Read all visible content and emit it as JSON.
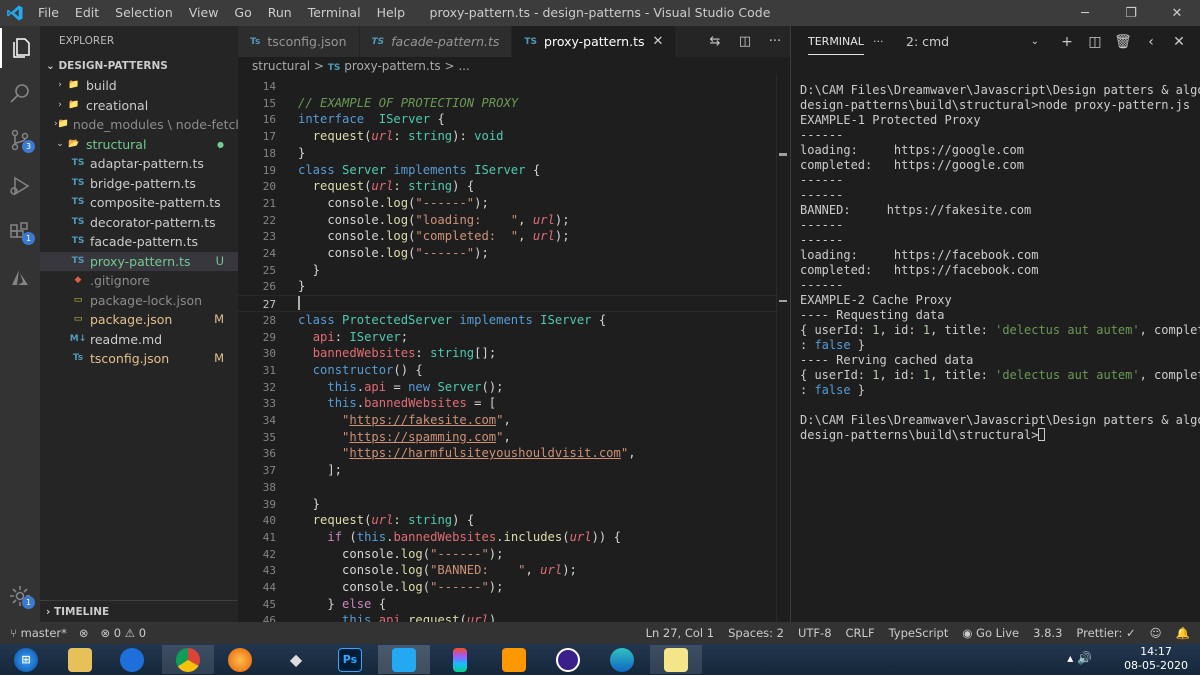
{
  "window": {
    "title": "proxy-pattern.ts - design-patterns - Visual Studio Code",
    "menu": [
      "File",
      "Edit",
      "Selection",
      "View",
      "Go",
      "Run",
      "Terminal",
      "Help"
    ]
  },
  "activity": {
    "scm_badge": "3",
    "ext_badge": "1",
    "settings_badge": "1"
  },
  "explorer": {
    "header": "EXPLORER",
    "project": "DESIGN-PATTERNS",
    "timeline": "TIMELINE",
    "items": [
      {
        "label": "build",
        "type": "folder",
        "status": ""
      },
      {
        "label": "creational",
        "type": "folder",
        "status": ""
      },
      {
        "label": "node_modules \\ node-fetch",
        "type": "folder",
        "status": ""
      },
      {
        "label": "structural",
        "type": "folder-open",
        "status": "●"
      },
      {
        "label": "adaptar-pattern.ts",
        "type": "ts",
        "status": ""
      },
      {
        "label": "bridge-pattern.ts",
        "type": "ts",
        "status": ""
      },
      {
        "label": "composite-pattern.ts",
        "type": "ts",
        "status": ""
      },
      {
        "label": "decorator-pattern.ts",
        "type": "ts",
        "status": ""
      },
      {
        "label": "facade-pattern.ts",
        "type": "ts",
        "status": ""
      },
      {
        "label": "proxy-pattern.ts",
        "type": "ts",
        "status": "U"
      },
      {
        "label": ".gitignore",
        "type": "git",
        "status": ""
      },
      {
        "label": "package-lock.json",
        "type": "json",
        "status": ""
      },
      {
        "label": "package.json",
        "type": "json",
        "status": "M"
      },
      {
        "label": "readme.md",
        "type": "md",
        "status": ""
      },
      {
        "label": "tsconfig.json",
        "type": "tsconfig",
        "status": "M"
      }
    ]
  },
  "tabs": [
    {
      "icon": "Ts",
      "label": "tsconfig.json",
      "active": false
    },
    {
      "icon": "TS",
      "label": "facade-pattern.ts",
      "active": false
    },
    {
      "icon": "TS",
      "label": "proxy-pattern.ts",
      "active": true
    }
  ],
  "breadcrumb": {
    "folder": "structural",
    "sep": ">",
    "icon": "TS",
    "file": "proxy-pattern.ts",
    "rest": "> ..."
  },
  "editor": {
    "lines": [
      {
        "n": "14",
        "code": []
      },
      {
        "n": "15",
        "code": [
          [
            "c-com",
            "// EXAMPLE OF PROTECTION PROXY"
          ]
        ]
      },
      {
        "n": "16",
        "code": [
          [
            "c-kw2",
            "interface"
          ],
          [
            "",
            "  "
          ],
          [
            "c-typ",
            "IServer"
          ],
          [
            "",
            " {"
          ]
        ]
      },
      {
        "n": "17",
        "code": [
          [
            "",
            "  "
          ],
          [
            "c-fn",
            "request"
          ],
          [
            "",
            "("
          ],
          [
            "c-prm",
            "url"
          ],
          [
            "",
            ": "
          ],
          [
            "c-typ",
            "string"
          ],
          [
            "",
            "): "
          ],
          [
            "c-typ",
            "void"
          ]
        ]
      },
      {
        "n": "18",
        "code": [
          [
            "",
            "}"
          ]
        ]
      },
      {
        "n": "19",
        "code": [
          [
            "c-kw2",
            "class"
          ],
          [
            "c-typ",
            " Server"
          ],
          [
            "c-kw2",
            " implements"
          ],
          [
            "c-typ",
            " IServer"
          ],
          [
            "",
            " {"
          ]
        ]
      },
      {
        "n": "20",
        "code": [
          [
            "",
            "  "
          ],
          [
            "c-fn",
            "request"
          ],
          [
            "",
            "("
          ],
          [
            "c-prm",
            "url"
          ],
          [
            "",
            ": "
          ],
          [
            "c-typ",
            "string"
          ],
          [
            "",
            ") {"
          ]
        ]
      },
      {
        "n": "21",
        "code": [
          [
            "",
            "    console."
          ],
          [
            "c-fn",
            "log"
          ],
          [
            "",
            "("
          ],
          [
            "c-str",
            "\"------\""
          ],
          [
            "",
            ");"
          ]
        ]
      },
      {
        "n": "22",
        "code": [
          [
            "",
            "    console."
          ],
          [
            "c-fn",
            "log"
          ],
          [
            "",
            "("
          ],
          [
            "c-str",
            "\"loading:    \""
          ],
          [
            "",
            ", "
          ],
          [
            "c-prm",
            "url"
          ],
          [
            "",
            ");"
          ]
        ]
      },
      {
        "n": "23",
        "code": [
          [
            "",
            "    console."
          ],
          [
            "c-fn",
            "log"
          ],
          [
            "",
            "("
          ],
          [
            "c-str",
            "\"completed:  \""
          ],
          [
            "",
            ", "
          ],
          [
            "c-prm",
            "url"
          ],
          [
            "",
            ");"
          ]
        ]
      },
      {
        "n": "24",
        "code": [
          [
            "",
            "    console."
          ],
          [
            "c-fn",
            "log"
          ],
          [
            "",
            "("
          ],
          [
            "c-str",
            "\"------\""
          ],
          [
            "",
            ");"
          ]
        ]
      },
      {
        "n": "25",
        "code": [
          [
            "",
            "  }"
          ]
        ]
      },
      {
        "n": "26",
        "code": [
          [
            "",
            "}"
          ]
        ]
      },
      {
        "n": "27",
        "code": []
      },
      {
        "n": "28",
        "code": [
          [
            "c-kw2",
            "class"
          ],
          [
            "c-typ",
            " ProtectedServer"
          ],
          [
            "c-kw2",
            " implements"
          ],
          [
            "c-typ",
            " IServer"
          ],
          [
            "",
            " {"
          ]
        ]
      },
      {
        "n": "29",
        "code": [
          [
            "",
            "  "
          ],
          [
            "c-pr",
            "api"
          ],
          [
            "",
            ": "
          ],
          [
            "c-typ",
            "IServer"
          ],
          [
            "",
            ";"
          ]
        ]
      },
      {
        "n": "30",
        "code": [
          [
            "",
            "  "
          ],
          [
            "c-pr",
            "bannedWebsites"
          ],
          [
            "",
            ": "
          ],
          [
            "c-typ",
            "string"
          ],
          [
            "",
            "[];"
          ]
        ]
      },
      {
        "n": "31",
        "code": [
          [
            "",
            "  "
          ],
          [
            "c-kw2",
            "constructor"
          ],
          [
            "",
            "() {"
          ]
        ]
      },
      {
        "n": "32",
        "code": [
          [
            "",
            "    "
          ],
          [
            "c-this",
            "this"
          ],
          [
            "",
            "."
          ],
          [
            "c-pr",
            "api"
          ],
          [
            "",
            " = "
          ],
          [
            "c-kw2",
            "new"
          ],
          [
            "c-typ",
            " Server"
          ],
          [
            "",
            "();"
          ]
        ]
      },
      {
        "n": "33",
        "code": [
          [
            "",
            "    "
          ],
          [
            "c-this",
            "this"
          ],
          [
            "",
            "."
          ],
          [
            "c-pr",
            "bannedWebsites"
          ],
          [
            "",
            " = ["
          ]
        ]
      },
      {
        "n": "34",
        "code": [
          [
            "",
            "      "
          ],
          [
            "c-str",
            "\""
          ],
          [
            "c-url",
            "https://fakesite.com"
          ],
          [
            "c-str",
            "\""
          ],
          [
            "",
            ","
          ]
        ]
      },
      {
        "n": "35",
        "code": [
          [
            "",
            "      "
          ],
          [
            "c-str",
            "\""
          ],
          [
            "c-url",
            "https://spamming.com"
          ],
          [
            "c-str",
            "\""
          ],
          [
            "",
            ","
          ]
        ]
      },
      {
        "n": "36",
        "code": [
          [
            "",
            "      "
          ],
          [
            "c-str",
            "\""
          ],
          [
            "c-url",
            "https://harmfulsiteyoushouldvisit.com"
          ],
          [
            "c-str",
            "\""
          ],
          [
            "",
            ","
          ]
        ]
      },
      {
        "n": "37",
        "code": [
          [
            "",
            "    ];"
          ]
        ]
      },
      {
        "n": "38",
        "code": []
      },
      {
        "n": "39",
        "code": [
          [
            "",
            "  }"
          ]
        ]
      },
      {
        "n": "40",
        "code": [
          [
            "",
            "  "
          ],
          [
            "c-fn",
            "request"
          ],
          [
            "",
            "("
          ],
          [
            "c-prm",
            "url"
          ],
          [
            "",
            ": "
          ],
          [
            "c-typ",
            "string"
          ],
          [
            "",
            ") {"
          ]
        ]
      },
      {
        "n": "41",
        "code": [
          [
            "",
            "    "
          ],
          [
            "c-kw",
            "if"
          ],
          [
            "",
            " ("
          ],
          [
            "c-this",
            "this"
          ],
          [
            "",
            "."
          ],
          [
            "c-pr",
            "bannedWebsites"
          ],
          [
            "",
            "."
          ],
          [
            "c-fn",
            "includes"
          ],
          [
            "",
            "("
          ],
          [
            "c-prm",
            "url"
          ],
          [
            "",
            ")) {"
          ]
        ]
      },
      {
        "n": "42",
        "code": [
          [
            "",
            "      console."
          ],
          [
            "c-fn",
            "log"
          ],
          [
            "",
            "("
          ],
          [
            "c-str",
            "\"------\""
          ],
          [
            "",
            ");"
          ]
        ]
      },
      {
        "n": "43",
        "code": [
          [
            "",
            "      console."
          ],
          [
            "c-fn",
            "log"
          ],
          [
            "",
            "("
          ],
          [
            "c-str",
            "\"BANNED:    \""
          ],
          [
            "",
            ", "
          ],
          [
            "c-prm",
            "url"
          ],
          [
            "",
            ");"
          ]
        ]
      },
      {
        "n": "44",
        "code": [
          [
            "",
            "      console."
          ],
          [
            "c-fn",
            "log"
          ],
          [
            "",
            "("
          ],
          [
            "c-str",
            "\"------\""
          ],
          [
            "",
            ");"
          ]
        ]
      },
      {
        "n": "45",
        "code": [
          [
            "",
            "    } "
          ],
          [
            "c-kw",
            "else"
          ],
          [
            "",
            " {"
          ]
        ]
      },
      {
        "n": "46",
        "code": [
          [
            "",
            "      "
          ],
          [
            "c-this",
            "this"
          ],
          [
            "",
            "."
          ],
          [
            "c-pr",
            "api"
          ],
          [
            "",
            "."
          ],
          [
            "c-fn",
            "request"
          ],
          [
            "",
            "("
          ],
          [
            "c-prm",
            "url"
          ],
          [
            "",
            ")"
          ]
        ]
      }
    ]
  },
  "panel": {
    "tab": "TERMINAL",
    "more": "···",
    "shell": "2: cmd",
    "lines": [
      [
        [
          "",
          "D:\\CAM Files\\Dreamwaver\\Javascript\\Design patters & algos\\"
        ]
      ],
      [
        [
          "",
          "design-patterns\\build\\structural>node proxy-pattern.js"
        ]
      ],
      [
        [
          "",
          "EXAMPLE-1 Protected Proxy"
        ]
      ],
      [
        [
          "",
          "------"
        ]
      ],
      [
        [
          "",
          "loading:     https://google.com"
        ]
      ],
      [
        [
          "",
          "completed:   https://google.com"
        ]
      ],
      [
        [
          "",
          "------"
        ]
      ],
      [
        [
          "",
          "------"
        ]
      ],
      [
        [
          "",
          "BANNED:     https://fakesite.com"
        ]
      ],
      [
        [
          "",
          "------"
        ]
      ],
      [
        [
          "",
          "------"
        ]
      ],
      [
        [
          "",
          "loading:     https://facebook.com"
        ]
      ],
      [
        [
          "",
          "completed:   https://facebook.com"
        ]
      ],
      [
        [
          "",
          "------"
        ]
      ],
      [
        [
          "",
          "EXAMPLE-2 Cache Proxy"
        ]
      ],
      [
        [
          "",
          "---- Requesting data"
        ]
      ],
      [
        [
          "",
          "{ userId: "
        ],
        [
          "t-num",
          "1"
        ],
        [
          "",
          ", id: "
        ],
        [
          "t-num",
          "1"
        ],
        [
          "",
          ", title: "
        ],
        [
          "t-str",
          "'delectus aut autem'"
        ],
        [
          "",
          ", completed"
        ]
      ],
      [
        [
          "",
          ": "
        ],
        [
          "t-kw",
          "false"
        ],
        [
          "",
          " }"
        ]
      ],
      [
        [
          "",
          "---- Rerving cached data"
        ]
      ],
      [
        [
          "",
          "{ userId: "
        ],
        [
          "t-num",
          "1"
        ],
        [
          "",
          ", id: "
        ],
        [
          "t-num",
          "1"
        ],
        [
          "",
          ", title: "
        ],
        [
          "t-str",
          "'delectus aut autem'"
        ],
        [
          "",
          ", completed"
        ]
      ],
      [
        [
          "",
          ": "
        ],
        [
          "t-kw",
          "false"
        ],
        [
          "",
          " }"
        ]
      ],
      [
        [
          "",
          ""
        ]
      ],
      [
        [
          "",
          "D:\\CAM Files\\Dreamwaver\\Javascript\\Design patters & algos\\"
        ]
      ],
      [
        [
          "",
          "design-patterns\\build\\structural>"
        ]
      ]
    ]
  },
  "status": {
    "branch": "master*",
    "live": "⊗",
    "problems": "⊗ 0 ⚠ 0",
    "position": "Ln 27, Col 1",
    "spaces": "Spaces: 2",
    "encoding": "UTF-8",
    "eol": "CRLF",
    "language": "TypeScript",
    "golive": "Go Live",
    "version": "3.8.3",
    "prettier": "Prettier: ✓"
  },
  "taskbar": {
    "time": "14:17",
    "date": "08-05-2020",
    "ps_label": "Ps"
  }
}
